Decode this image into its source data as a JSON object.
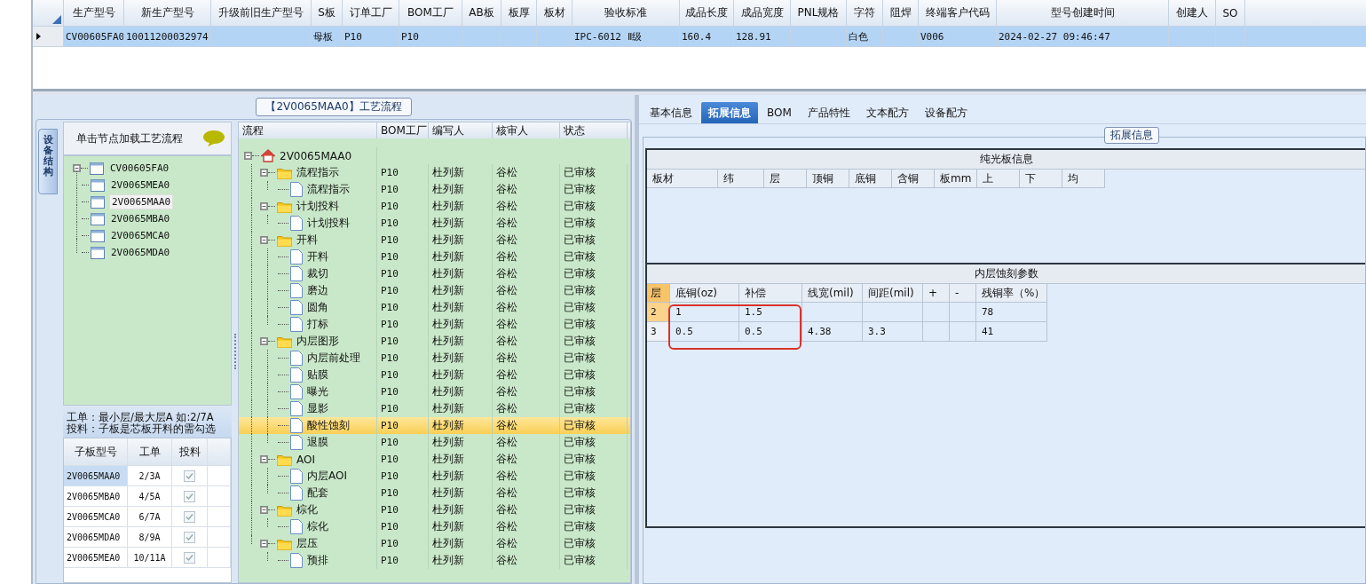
{
  "product_grid": {
    "columns": [
      "生产型号",
      "新生产型号",
      "升级前旧生产型号",
      "S板",
      "订单工厂",
      "BOM工厂",
      "AB板",
      "板厚",
      "板材",
      "验收标准",
      "成品长度",
      "成品宽度",
      "PNL规格",
      "字符",
      "阻焊",
      "终端客户代码",
      "型号创建时间",
      "创建人",
      "SO"
    ],
    "rows": [
      {
        "selected": true,
        "cells": [
          "CV00605FA0",
          "10011200032974",
          "",
          "母板",
          "P10",
          "P10",
          "",
          "",
          "",
          "IPC-6012 Ⅱ级",
          "160.4",
          "128.91",
          "",
          "白色",
          "",
          "V006",
          "2024-02-27 09:46:47",
          "",
          ""
        ]
      }
    ]
  },
  "process_group": {
    "title": "【2V0065MAA0】工艺流程",
    "side_tab": "设备结构",
    "hint": "单击节点加载工艺流程",
    "board_tree": {
      "label": "CV00605FA0",
      "expanded": true,
      "children": [
        {
          "label": "2V0065MEA0",
          "selected": false
        },
        {
          "label": "2V0065MAA0",
          "selected": true
        },
        {
          "label": "2V0065MBA0",
          "selected": false
        },
        {
          "label": "2V0065MCA0",
          "selected": false
        },
        {
          "label": "2V0065MDA0",
          "selected": false
        }
      ]
    },
    "notes": [
      "工单：最小层/最大层A 如:2/7A",
      "投料：子板是芯板开料的需勾选"
    ],
    "sub_boards": {
      "columns": [
        "子板型号",
        "工单",
        "投料"
      ],
      "rows": [
        {
          "model": "2V0065MAA0",
          "order": "2/3A",
          "checked": true,
          "selected": true
        },
        {
          "model": "2V0065MBA0",
          "order": "4/5A",
          "checked": true,
          "selected": false
        },
        {
          "model": "2V0065MCA0",
          "order": "6/7A",
          "checked": true,
          "selected": false
        },
        {
          "model": "2V0065MDA0",
          "order": "8/9A",
          "checked": true,
          "selected": false
        },
        {
          "model": "2V0065MEA0",
          "order": "10/11A",
          "checked": true,
          "selected": false
        }
      ]
    },
    "flow": {
      "columns": [
        "流程",
        "BOM工厂",
        "编写人",
        "核审人",
        "状态"
      ],
      "root": {
        "label": "2V0065MAA0",
        "expanded": true,
        "children": [
          {
            "label": "流程指示",
            "bom": "P10",
            "writer": "杜列新",
            "reviewer": "谷松",
            "status": "已审核",
            "expanded": true,
            "selected": false,
            "children": [
              {
                "label": "流程指示",
                "bom": "P10",
                "writer": "杜列新",
                "reviewer": "谷松",
                "status": "已审核",
                "selected": false
              }
            ]
          },
          {
            "label": "计划投料",
            "bom": "P10",
            "writer": "杜列新",
            "reviewer": "谷松",
            "status": "已审核",
            "expanded": true,
            "selected": false,
            "children": [
              {
                "label": "计划投料",
                "bom": "P10",
                "writer": "杜列新",
                "reviewer": "谷松",
                "status": "已审核",
                "selected": false
              }
            ]
          },
          {
            "label": "开料",
            "bom": "P10",
            "writer": "杜列新",
            "reviewer": "谷松",
            "status": "已审核",
            "expanded": true,
            "selected": false,
            "children": [
              {
                "label": "开料",
                "bom": "P10",
                "writer": "杜列新",
                "reviewer": "谷松",
                "status": "已审核",
                "selected": false
              },
              {
                "label": "裁切",
                "bom": "P10",
                "writer": "杜列新",
                "reviewer": "谷松",
                "status": "已审核",
                "selected": false
              },
              {
                "label": "磨边",
                "bom": "P10",
                "writer": "杜列新",
                "reviewer": "谷松",
                "status": "已审核",
                "selected": false
              },
              {
                "label": "圆角",
                "bom": "P10",
                "writer": "杜列新",
                "reviewer": "谷松",
                "status": "已审核",
                "selected": false
              },
              {
                "label": "打标",
                "bom": "P10",
                "writer": "杜列新",
                "reviewer": "谷松",
                "status": "已审核",
                "selected": false
              }
            ]
          },
          {
            "label": "内层图形",
            "bom": "P10",
            "writer": "杜列新",
            "reviewer": "谷松",
            "status": "已审核",
            "expanded": true,
            "selected": false,
            "children": [
              {
                "label": "内层前处理",
                "bom": "P10",
                "writer": "杜列新",
                "reviewer": "谷松",
                "status": "已审核",
                "selected": false
              },
              {
                "label": "贴膜",
                "bom": "P10",
                "writer": "杜列新",
                "reviewer": "谷松",
                "status": "已审核",
                "selected": false
              },
              {
                "label": "曝光",
                "bom": "P10",
                "writer": "杜列新",
                "reviewer": "谷松",
                "status": "已审核",
                "selected": false
              },
              {
                "label": "显影",
                "bom": "P10",
                "writer": "杜列新",
                "reviewer": "谷松",
                "status": "已审核",
                "selected": false
              },
              {
                "label": "酸性蚀刻",
                "bom": "P10",
                "writer": "杜列新",
                "reviewer": "谷松",
                "status": "已审核",
                "selected": true
              },
              {
                "label": "退膜",
                "bom": "P10",
                "writer": "杜列新",
                "reviewer": "谷松",
                "status": "已审核",
                "selected": false
              }
            ]
          },
          {
            "label": "AOI",
            "bom": "P10",
            "writer": "杜列新",
            "reviewer": "谷松",
            "status": "已审核",
            "expanded": true,
            "selected": false,
            "children": [
              {
                "label": "内层AOI",
                "bom": "P10",
                "writer": "杜列新",
                "reviewer": "谷松",
                "status": "已审核",
                "selected": false
              },
              {
                "label": "配套",
                "bom": "P10",
                "writer": "杜列新",
                "reviewer": "谷松",
                "status": "已审核",
                "selected": false
              }
            ]
          },
          {
            "label": "棕化",
            "bom": "P10",
            "writer": "杜列新",
            "reviewer": "谷松",
            "status": "已审核",
            "expanded": true,
            "selected": false,
            "children": [
              {
                "label": "棕化",
                "bom": "P10",
                "writer": "杜列新",
                "reviewer": "谷松",
                "status": "已审核",
                "selected": false
              }
            ]
          },
          {
            "label": "层压",
            "bom": "P10",
            "writer": "杜列新",
            "reviewer": "谷松",
            "status": "已审核",
            "expanded": true,
            "selected": false,
            "children": [
              {
                "label": "预排",
                "bom": "P10",
                "writer": "杜列新",
                "reviewer": "谷松",
                "status": "已审核",
                "selected": false
              }
            ]
          }
        ]
      }
    }
  },
  "detail": {
    "tabs": [
      {
        "label": "基本信息",
        "selected": false
      },
      {
        "label": "拓展信息",
        "selected": true
      },
      {
        "label": "BOM",
        "selected": false
      },
      {
        "label": "产品特性",
        "selected": false
      },
      {
        "label": "文本配方",
        "selected": false
      },
      {
        "label": "设备配方",
        "selected": false
      }
    ],
    "group_title": "拓展信息",
    "bare_board": {
      "title": "纯光板信息",
      "columns": [
        "板材",
        "纬",
        "层",
        "顶铜",
        "底铜",
        "含铜",
        "板mm",
        "上",
        "下",
        "均"
      ]
    },
    "etch": {
      "title": "内层蚀刻参数",
      "columns": [
        "层",
        "底铜(oz)",
        "补偿",
        "线宽(mil)",
        "间距(mil)",
        "+",
        "-",
        "残铜率（%）"
      ],
      "rows": [
        {
          "selected": true,
          "cells": [
            "2",
            "1",
            "1.5",
            "",
            "",
            "",
            "",
            "78"
          ]
        },
        {
          "selected": false,
          "cells": [
            "3",
            "0.5",
            "0.5",
            "4.38",
            "3.3",
            "",
            "",
            "41"
          ]
        }
      ],
      "highlight": true
    }
  }
}
